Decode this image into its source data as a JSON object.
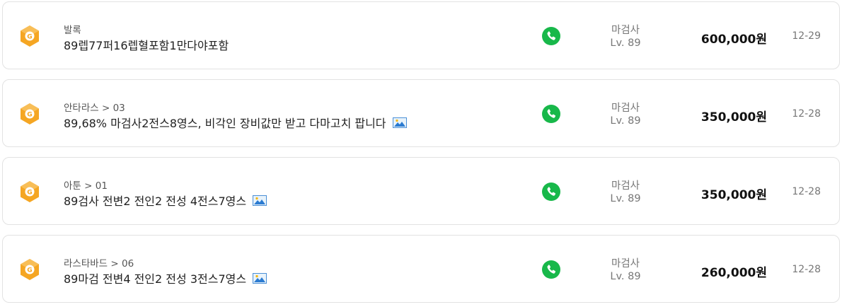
{
  "colors": {
    "badge": "#f5a623",
    "phone": "#18b84a",
    "border": "#e2e2e2"
  },
  "icons": {
    "badge": "game-badge-icon",
    "phone": "phone-icon",
    "image": "image-icon"
  },
  "listings": [
    {
      "server": "발록",
      "title": "89렙77퍼16렙혈포함1만다야포함",
      "has_image": false,
      "job": "마검사",
      "level": "Lv. 89",
      "price": "600,000원",
      "date": "12-29"
    },
    {
      "server": "안타라스 > 03",
      "title": "89,68% 마검사2전스8영스, 비각인 장비값만 받고 다마고치 팝니다",
      "has_image": true,
      "job": "마검사",
      "level": "Lv. 89",
      "price": "350,000원",
      "date": "12-28"
    },
    {
      "server": "아툰 > 01",
      "title": "89검사 전변2 전인2 전성 4전스7영스",
      "has_image": true,
      "job": "마검사",
      "level": "Lv. 89",
      "price": "350,000원",
      "date": "12-28"
    },
    {
      "server": "라스타바드 > 06",
      "title": "89마검 전변4 전인2 전성 3전스7영스",
      "has_image": true,
      "job": "마검사",
      "level": "Lv. 89",
      "price": "260,000원",
      "date": "12-28"
    }
  ]
}
